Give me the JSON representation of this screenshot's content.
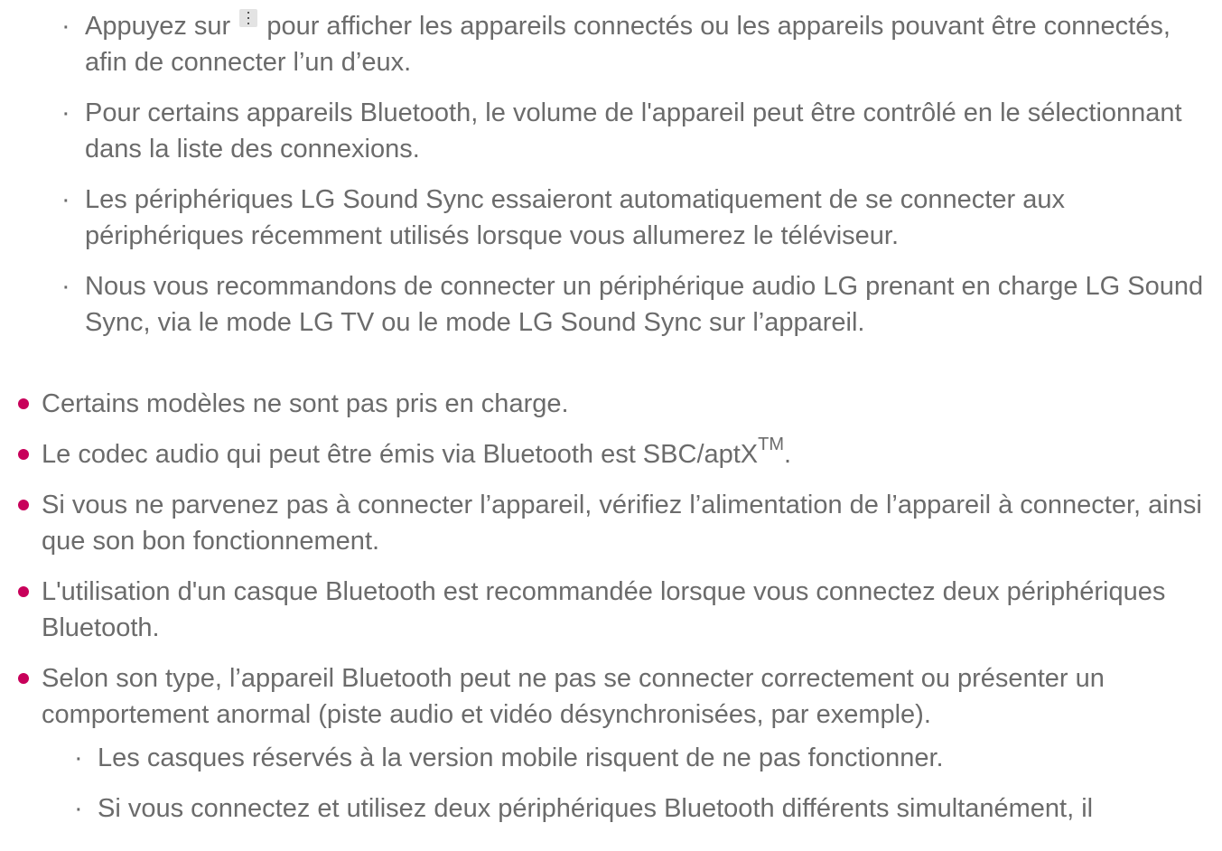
{
  "sub_dot": "·",
  "sub_items_top": [
    {
      "before_icon": "Appuyez sur",
      "icon": "more-vertical-icon",
      "after_icon": "pour afficher les appareils connectés ou les appareils pouvant être connectés, afin de connecter l’un d’eux."
    },
    {
      "text": "Pour certains appareils Bluetooth, le volume de l'appareil peut être contrôlé en le sélectionnant dans la liste des connexions."
    },
    {
      "text": "Les périphériques LG Sound Sync essaieront automatiquement de se connecter aux périphériques récemment utilisés lorsque vous allumerez le téléviseur."
    },
    {
      "text": "Nous vous recommandons de connecter un périphérique audio LG prenant en charge LG Sound Sync, via le mode LG TV ou le mode LG Sound Sync sur l’appareil."
    }
  ],
  "main_items": [
    {
      "text": "Certains modèles ne sont pas pris en charge."
    },
    {
      "text": "Le codec audio qui peut être émis via Bluetooth est SBC/aptX",
      "sup": "TM",
      "after": "."
    },
    {
      "text": "Si vous ne parvenez pas à connecter l’appareil, vérifiez l’alimentation de l’appareil à connecter, ainsi que son bon fonctionnement."
    },
    {
      "text": "L'utilisation d'un casque Bluetooth est recommandée lorsque vous connectez deux périphériques Bluetooth."
    },
    {
      "text": "Selon son type, l’appareil Bluetooth peut ne pas se connecter correctement ou présenter un comportement anormal (piste audio et vidéo désynchronisées, par exemple)."
    }
  ],
  "sub_items_bottom": [
    {
      "text": "Les casques réservés à la version mobile risquent de ne pas fonctionner."
    },
    {
      "text": "Si vous connectez et utilisez deux périphériques Bluetooth différents simultanément, il"
    }
  ],
  "colors": {
    "bullet": "#c8005a",
    "text": "#6b6b6b"
  }
}
